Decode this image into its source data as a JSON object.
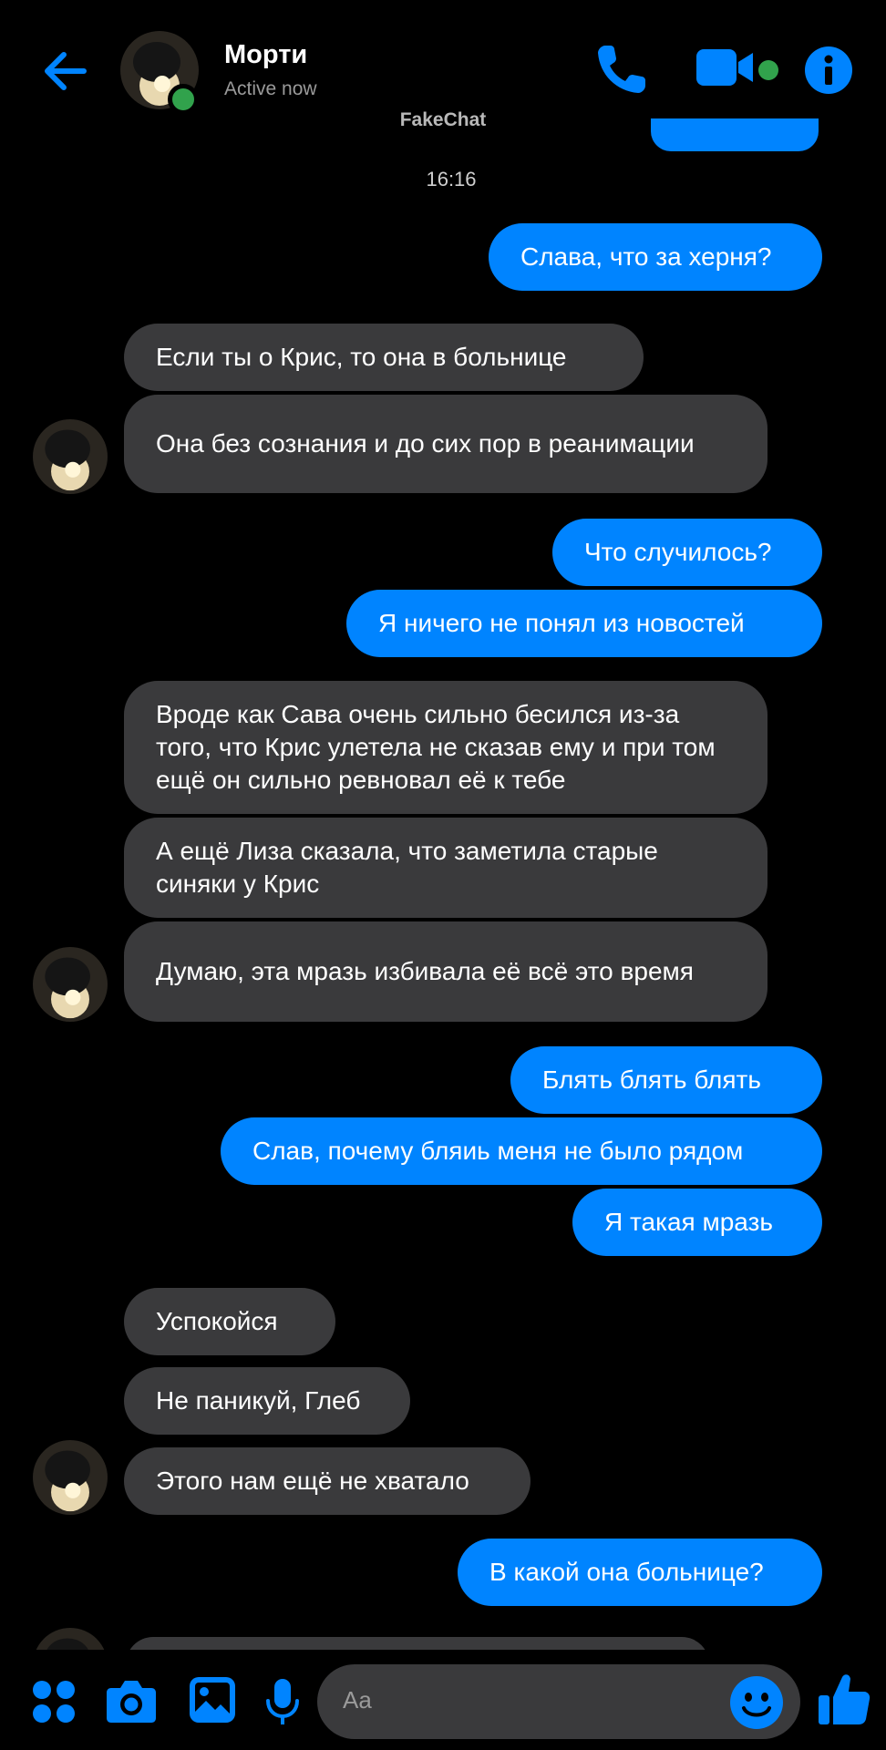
{
  "header": {
    "contact_name": "Морти",
    "status": "Active now",
    "app_label": "FakeChat"
  },
  "timestamp": "16:16",
  "messages": [
    {
      "dir": "out",
      "text": "Слава, что за херня?"
    },
    {
      "dir": "in",
      "text": "Если ты о Крис, то она в больнице"
    },
    {
      "dir": "in",
      "text": "Она без сознания и до сих пор в реанимации"
    },
    {
      "dir": "out",
      "text": "Что случилось?"
    },
    {
      "dir": "out",
      "text": "Я ничего не понял из новостей"
    },
    {
      "dir": "in",
      "text": "Вроде как Сава очень сильно бесился из-за того, что Крис улетела не сказав ему и при том ещё он сильно ревновал её к тебе"
    },
    {
      "dir": "in",
      "text": "А ещё Лиза сказала, что заметила старые синяки у Крис"
    },
    {
      "dir": "in",
      "text": "Думаю, эта мразь избивала её всё это время"
    },
    {
      "dir": "out",
      "text": "Блять блять блять"
    },
    {
      "dir": "out",
      "text": "Слав, почему бляиь меня не было рядом"
    },
    {
      "dir": "out",
      "text": "Я такая мразь"
    },
    {
      "dir": "in",
      "text": "Успокойся"
    },
    {
      "dir": "in",
      "text": "Не паникуй, Глеб"
    },
    {
      "dir": "in",
      "text": "Этого нам ещё не хватало"
    },
    {
      "dir": "out",
      "text": "В какой она больнице?"
    }
  ],
  "composer": {
    "placeholder": "Aa",
    "icons": [
      "apps-icon",
      "camera-icon",
      "gallery-icon",
      "microphone-icon",
      "emoji-icon",
      "like-icon"
    ]
  },
  "colors": {
    "accent": "#0084ff",
    "incoming_bubble": "#3a3a3c",
    "online": "#31a24c",
    "background": "#000000"
  }
}
